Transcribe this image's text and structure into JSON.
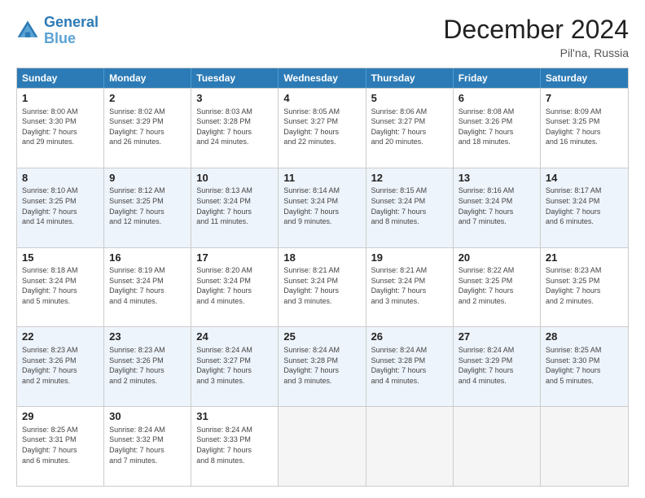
{
  "logo": {
    "line1": "General",
    "line2": "Blue"
  },
  "title": "December 2024",
  "location": "Pil'na, Russia",
  "days_of_week": [
    "Sunday",
    "Monday",
    "Tuesday",
    "Wednesday",
    "Thursday",
    "Friday",
    "Saturday"
  ],
  "weeks": [
    {
      "alt": false,
      "cells": [
        {
          "day": "1",
          "sunrise": "8:00 AM",
          "sunset": "3:30 PM",
          "daylight": "7 hours and 29 minutes."
        },
        {
          "day": "2",
          "sunrise": "8:02 AM",
          "sunset": "3:29 PM",
          "daylight": "7 hours and 26 minutes."
        },
        {
          "day": "3",
          "sunrise": "8:03 AM",
          "sunset": "3:28 PM",
          "daylight": "7 hours and 24 minutes."
        },
        {
          "day": "4",
          "sunrise": "8:05 AM",
          "sunset": "3:27 PM",
          "daylight": "7 hours and 22 minutes."
        },
        {
          "day": "5",
          "sunrise": "8:06 AM",
          "sunset": "3:27 PM",
          "daylight": "7 hours and 20 minutes."
        },
        {
          "day": "6",
          "sunrise": "8:08 AM",
          "sunset": "3:26 PM",
          "daylight": "7 hours and 18 minutes."
        },
        {
          "day": "7",
          "sunrise": "8:09 AM",
          "sunset": "3:25 PM",
          "daylight": "7 hours and 16 minutes."
        }
      ]
    },
    {
      "alt": true,
      "cells": [
        {
          "day": "8",
          "sunrise": "8:10 AM",
          "sunset": "3:25 PM",
          "daylight": "7 hours and 14 minutes."
        },
        {
          "day": "9",
          "sunrise": "8:12 AM",
          "sunset": "3:25 PM",
          "daylight": "7 hours and 12 minutes."
        },
        {
          "day": "10",
          "sunrise": "8:13 AM",
          "sunset": "3:24 PM",
          "daylight": "7 hours and 11 minutes."
        },
        {
          "day": "11",
          "sunrise": "8:14 AM",
          "sunset": "3:24 PM",
          "daylight": "7 hours and 9 minutes."
        },
        {
          "day": "12",
          "sunrise": "8:15 AM",
          "sunset": "3:24 PM",
          "daylight": "7 hours and 8 minutes."
        },
        {
          "day": "13",
          "sunrise": "8:16 AM",
          "sunset": "3:24 PM",
          "daylight": "7 hours and 7 minutes."
        },
        {
          "day": "14",
          "sunrise": "8:17 AM",
          "sunset": "3:24 PM",
          "daylight": "7 hours and 6 minutes."
        }
      ]
    },
    {
      "alt": false,
      "cells": [
        {
          "day": "15",
          "sunrise": "8:18 AM",
          "sunset": "3:24 PM",
          "daylight": "7 hours and 5 minutes."
        },
        {
          "day": "16",
          "sunrise": "8:19 AM",
          "sunset": "3:24 PM",
          "daylight": "7 hours and 4 minutes."
        },
        {
          "day": "17",
          "sunrise": "8:20 AM",
          "sunset": "3:24 PM",
          "daylight": "7 hours and 4 minutes."
        },
        {
          "day": "18",
          "sunrise": "8:21 AM",
          "sunset": "3:24 PM",
          "daylight": "7 hours and 3 minutes."
        },
        {
          "day": "19",
          "sunrise": "8:21 AM",
          "sunset": "3:24 PM",
          "daylight": "7 hours and 3 minutes."
        },
        {
          "day": "20",
          "sunrise": "8:22 AM",
          "sunset": "3:25 PM",
          "daylight": "7 hours and 2 minutes."
        },
        {
          "day": "21",
          "sunrise": "8:23 AM",
          "sunset": "3:25 PM",
          "daylight": "7 hours and 2 minutes."
        }
      ]
    },
    {
      "alt": true,
      "cells": [
        {
          "day": "22",
          "sunrise": "8:23 AM",
          "sunset": "3:26 PM",
          "daylight": "7 hours and 2 minutes."
        },
        {
          "day": "23",
          "sunrise": "8:23 AM",
          "sunset": "3:26 PM",
          "daylight": "7 hours and 2 minutes."
        },
        {
          "day": "24",
          "sunrise": "8:24 AM",
          "sunset": "3:27 PM",
          "daylight": "7 hours and 3 minutes."
        },
        {
          "day": "25",
          "sunrise": "8:24 AM",
          "sunset": "3:28 PM",
          "daylight": "7 hours and 3 minutes."
        },
        {
          "day": "26",
          "sunrise": "8:24 AM",
          "sunset": "3:28 PM",
          "daylight": "7 hours and 4 minutes."
        },
        {
          "day": "27",
          "sunrise": "8:24 AM",
          "sunset": "3:29 PM",
          "daylight": "7 hours and 4 minutes."
        },
        {
          "day": "28",
          "sunrise": "8:25 AM",
          "sunset": "3:30 PM",
          "daylight": "7 hours and 5 minutes."
        }
      ]
    },
    {
      "alt": false,
      "cells": [
        {
          "day": "29",
          "sunrise": "8:25 AM",
          "sunset": "3:31 PM",
          "daylight": "7 hours and 6 minutes."
        },
        {
          "day": "30",
          "sunrise": "8:24 AM",
          "sunset": "3:32 PM",
          "daylight": "7 hours and 7 minutes."
        },
        {
          "day": "31",
          "sunrise": "8:24 AM",
          "sunset": "3:33 PM",
          "daylight": "7 hours and 8 minutes."
        },
        {
          "day": "",
          "sunrise": "",
          "sunset": "",
          "daylight": ""
        },
        {
          "day": "",
          "sunrise": "",
          "sunset": "",
          "daylight": ""
        },
        {
          "day": "",
          "sunrise": "",
          "sunset": "",
          "daylight": ""
        },
        {
          "day": "",
          "sunrise": "",
          "sunset": "",
          "daylight": ""
        }
      ]
    }
  ]
}
